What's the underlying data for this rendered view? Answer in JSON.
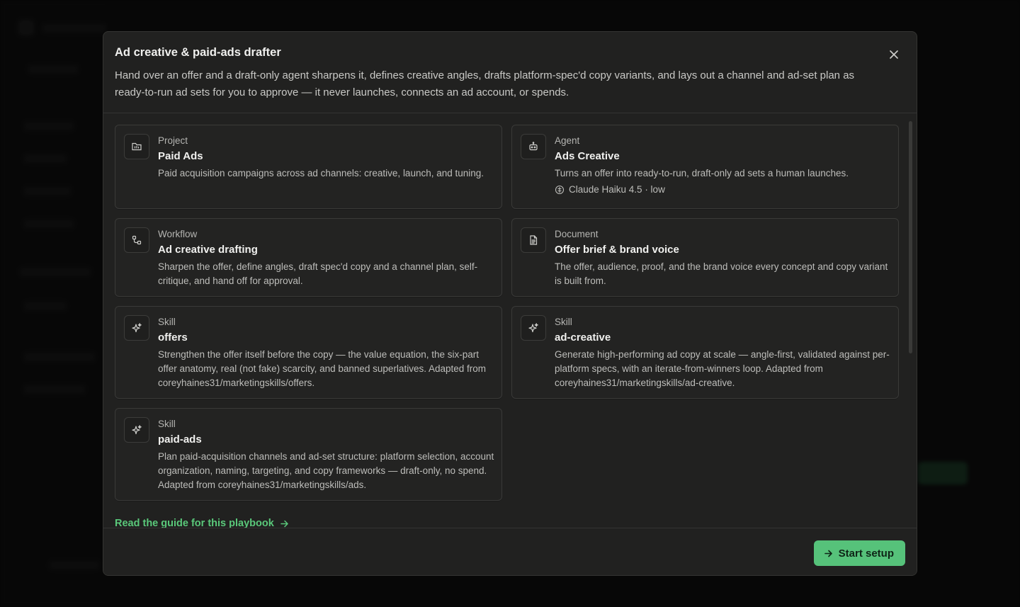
{
  "modal": {
    "title": "Ad creative & paid-ads drafter",
    "description": "Hand over an offer and a draft-only agent sharpens it, defines creative angles, drafts platform-spec'd copy variants, and lays out a channel and ad-set plan as ready-to-run ad sets for you to approve — it never launches, connects an ad account, or spends."
  },
  "cards": [
    {
      "kind": "Project",
      "name": "Paid Ads",
      "desc": "Paid acquisition campaigns across ad channels: creative, launch, and tuning.",
      "icon": "folder-icon"
    },
    {
      "kind": "Agent",
      "name": "Ads Creative",
      "desc": "Turns an offer into ready-to-run, draft-only ad sets a human launches.",
      "meta": "Claude Haiku 4.5 · low",
      "icon": "robot-icon"
    },
    {
      "kind": "Workflow",
      "name": "Ad creative drafting",
      "desc": "Sharpen the offer, define angles, draft spec'd copy and a channel plan, self-critique, and hand off for approval.",
      "icon": "workflow-icon"
    },
    {
      "kind": "Document",
      "name": "Offer brief & brand voice",
      "desc": "The offer, audience, proof, and the brand voice every concept and copy variant is built from.",
      "icon": "document-icon"
    },
    {
      "kind": "Skill",
      "name": "offers",
      "desc": "Strengthen the offer itself before the copy — the value equation, the six-part offer anatomy, real (not fake) scarcity, and banned superlatives. Adapted from coreyhaines31/marketingskills/offers.",
      "icon": "sparkle-icon"
    },
    {
      "kind": "Skill",
      "name": "ad-creative",
      "desc": "Generate high-performing ad copy at scale — angle-first, validated against per-platform specs, with an iterate-from-winners loop. Adapted from coreyhaines31/marketingskills/ad-creative.",
      "icon": "sparkle-icon"
    },
    {
      "kind": "Skill",
      "name": "paid-ads",
      "desc": "Plan paid-acquisition channels and ad-set structure: platform selection, account organization, naming, targeting, and copy frameworks — draft-only, no spend. Adapted from coreyhaines31/marketingskills/ads.",
      "icon": "sparkle-icon"
    }
  ],
  "guide_link": "Read the guide for this playbook",
  "footer": {
    "start_label": "Start setup"
  },
  "colors": {
    "accent": "#56c27a",
    "link": "#5ac87a",
    "modal_bg": "#212120"
  }
}
